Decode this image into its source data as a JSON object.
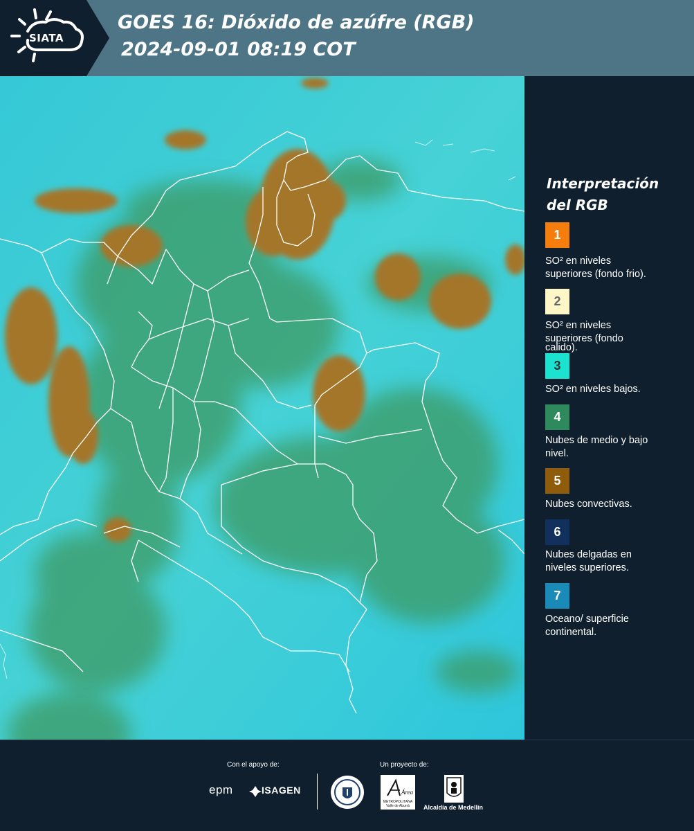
{
  "header": {
    "logo_text": "SIATA",
    "title_line1": "GOES 16: Dióxido de azúfre (RGB)",
    "title_line2": "2024-09-01 08:19 COT"
  },
  "legend": {
    "title_line1": "Interpretación",
    "title_line2": "del RGB",
    "items": [
      {
        "number": "1",
        "color": "#f57d0e",
        "text_color": "#ffffff",
        "label_line1": "SO² en niveles",
        "label_line2": "superiores (fondo frio)."
      },
      {
        "number": "2",
        "color": "#fdf7c7",
        "text_color": "#666666",
        "label_line1": "SO² en niveles",
        "label_line2": "superiores (fondo",
        "label_line3": "calido)."
      },
      {
        "number": "3",
        "color": "#1be3d0",
        "text_color": "#333333",
        "label_line1": "SO² en niveles bajos."
      },
      {
        "number": "4",
        "color": "#2e8a5c",
        "text_color": "#ffffff",
        "label_line1": "Nubes de medio y bajo",
        "label_line2": "nivel."
      },
      {
        "number": "5",
        "color": "#8f5c0c",
        "text_color": "#ffffff",
        "label_line1": "Nubes convectivas."
      },
      {
        "number": "6",
        "color": "#11305e",
        "text_color": "#ffffff",
        "label_line1": "Nubes delgadas en",
        "label_line2": "niveles superiores."
      },
      {
        "number": "7",
        "color": "#1a8ab8",
        "text_color": "#ffffff",
        "label_line1": "Oceano/ superficie",
        "label_line2": "continental."
      }
    ]
  },
  "map": {
    "colors": {
      "background": "#2fc7d3",
      "ocean_light": "#3cd4dc",
      "low_cloud": "#3f9a62",
      "convective": "#a3752b",
      "borders": "#ffffff"
    }
  },
  "footer": {
    "support_caption": "Con el apoyo de:",
    "project_caption": "Un proyecto de:",
    "epm": "epm",
    "isagen": "ISAGEN",
    "amva_brand": "Área",
    "amva_subtitle": "METROPOLITANA Valle de Aburrá",
    "alcaldia": "Alcaldía de Medellín"
  }
}
